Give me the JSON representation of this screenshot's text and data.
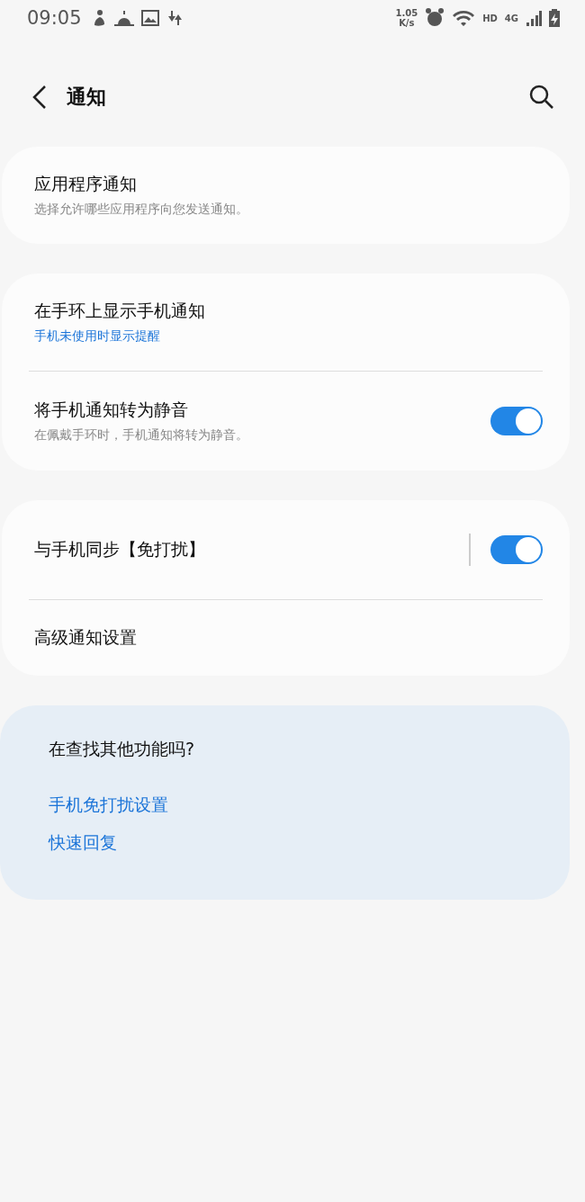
{
  "status_bar": {
    "time": "09:05",
    "speed": "1.05",
    "speed_unit": "K/s",
    "hd": "HD",
    "network": "4G"
  },
  "header": {
    "title": "通知"
  },
  "groups": [
    {
      "items": [
        {
          "kind": "link",
          "title": "应用程序通知",
          "subtitle": "选择允许哪些应用程序向您发送通知。",
          "accent": false
        }
      ]
    },
    {
      "items": [
        {
          "kind": "link",
          "title": "在手环上显示手机通知",
          "subtitle": "手机未使用时显示提醒",
          "accent": true
        },
        {
          "kind": "toggle",
          "title": "将手机通知转为静音",
          "subtitle": "在佩戴手环时，手机通知将转为静音。",
          "accent": false,
          "on": true
        }
      ]
    },
    {
      "items": [
        {
          "kind": "split-toggle",
          "title": "与手机同步【免打扰】",
          "on": true
        },
        {
          "kind": "link",
          "title": "高级通知设置"
        }
      ]
    }
  ],
  "suggestions": {
    "title": "在查找其他功能吗?",
    "links": [
      "手机免打扰设置",
      "快速回复"
    ]
  }
}
